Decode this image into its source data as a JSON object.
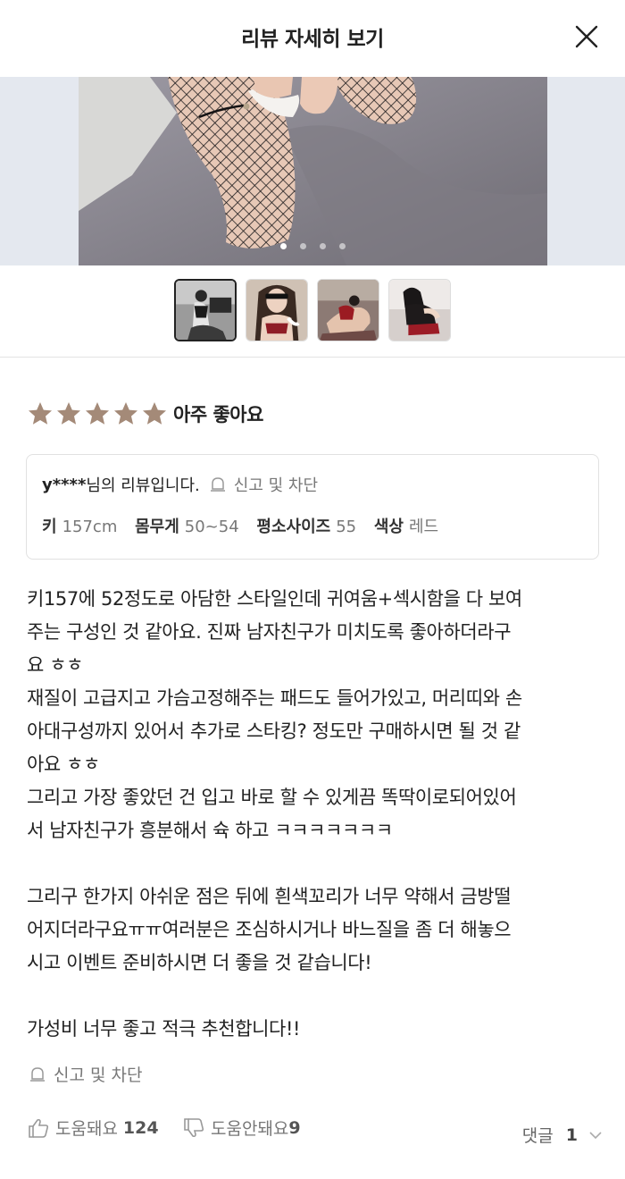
{
  "header": {
    "title": "리뷰 자세히 보기"
  },
  "gallery": {
    "image_count": 4,
    "active_index": 0,
    "selected_thumb": 0
  },
  "rating": {
    "stars": 5,
    "max": 5,
    "label": "아주 좋아요",
    "star_color": "#a48a78"
  },
  "reviewer": {
    "name": "y****",
    "suffix": "님의 리뷰입니다.",
    "report_label": "신고 및 차단",
    "specs": [
      {
        "key": "키",
        "value": "157cm"
      },
      {
        "key": "몸무게",
        "value": "50~54"
      },
      {
        "key": "평소사이즈",
        "value": "55"
      },
      {
        "key": "색상",
        "value": "레드"
      }
    ]
  },
  "review": {
    "lines": [
      "키157에 52정도로 아담한 스타일인데 귀여움+섹시함을 다 보여",
      "주는 구성인 것 같아요. 진짜 남자친구가 미치도록 좋아하더라구",
      "요 ㅎㅎ",
      "재질이 고급지고 가슴고정해주는 패드도 들어가있고, 머리띠와 손",
      "아대구성까지 있어서 추가로 스타킹? 정도만 구매하시면 될 것 같",
      "아요 ㅎㅎ",
      "그리고 가장 좋았던 건 입고 바로 할 수 있게끔 똑딱이로되어있어",
      "서 남자친구가 흥분해서 슉 하고 ㅋㅋㅋㅋㅋㅋㅋ",
      "",
      "그리구 한가지 아쉬운 점은 뒤에 흰색꼬리가 너무 약해서 금방떨",
      "어지더라구요ㅠㅠ여러분은 조심하시거나 바느질을 좀 더 해놓으",
      "시고 이벤트 준비하시면 더 좋을 것 같습니다!",
      "",
      "가성비 너무 좋고 적극 추천합니다!!"
    ]
  },
  "footer": {
    "report_label": "신고 및 차단",
    "helpful_label": "도움돼요",
    "helpful_count": "124",
    "unhelpful_label": "도움안돼요",
    "unhelpful_count": "9",
    "comments_label": "댓글",
    "comments_count": "1"
  }
}
